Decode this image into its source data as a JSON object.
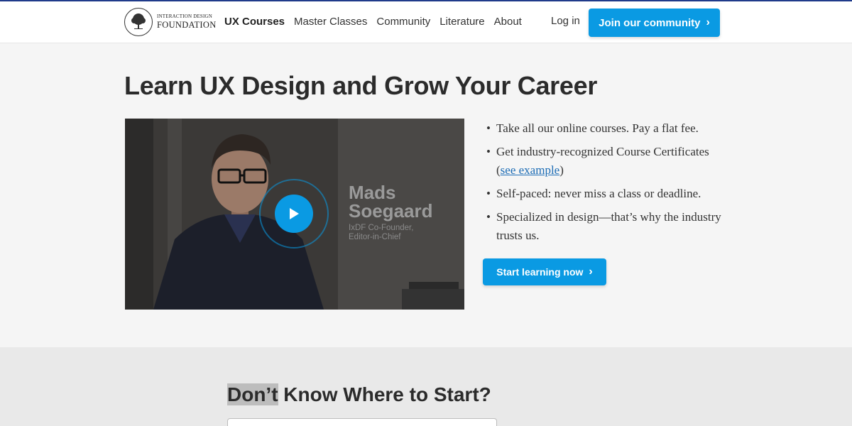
{
  "header": {
    "logo": {
      "line1": "INTERACTION DESIGN",
      "line2": "FOUNDATION"
    },
    "nav": [
      {
        "label": "UX Courses",
        "active": true
      },
      {
        "label": "Master Classes",
        "active": false
      },
      {
        "label": "Community",
        "active": false
      },
      {
        "label": "Literature",
        "active": false
      },
      {
        "label": "About",
        "active": false
      }
    ],
    "login_label": "Log in",
    "join_label": "Join our community",
    "join_icon": "chevron-right-icon"
  },
  "hero": {
    "title": "Learn UX Design and Grow Your Career",
    "video": {
      "name_line1": "Mads",
      "name_line2": "Soegaard",
      "role_line1": "IxDF Co-Founder,",
      "role_line2": "Editor-in-Chief",
      "play_icon": "play-icon"
    },
    "bullets": {
      "b1": "Take all our online courses. Pay a flat fee.",
      "b2_prefix": "Get industry-recognized Course Certificates (",
      "b2_link": "see example",
      "b2_suffix": ")",
      "b3": "Self-paced: never miss a class or deadline.",
      "b4": "Specialized in design—that’s why the industry trusts us."
    },
    "cta_label": "Start learning now"
  },
  "section2": {
    "title_highlight": "Don’t",
    "title_rest": " Know Where to Start?"
  },
  "colors": {
    "accent": "#0a9ae3",
    "link": "#1c6cb5",
    "heading": "#2b2b2b",
    "page_bg": "#f5f5f5",
    "section_bg": "#e9e9e9"
  }
}
